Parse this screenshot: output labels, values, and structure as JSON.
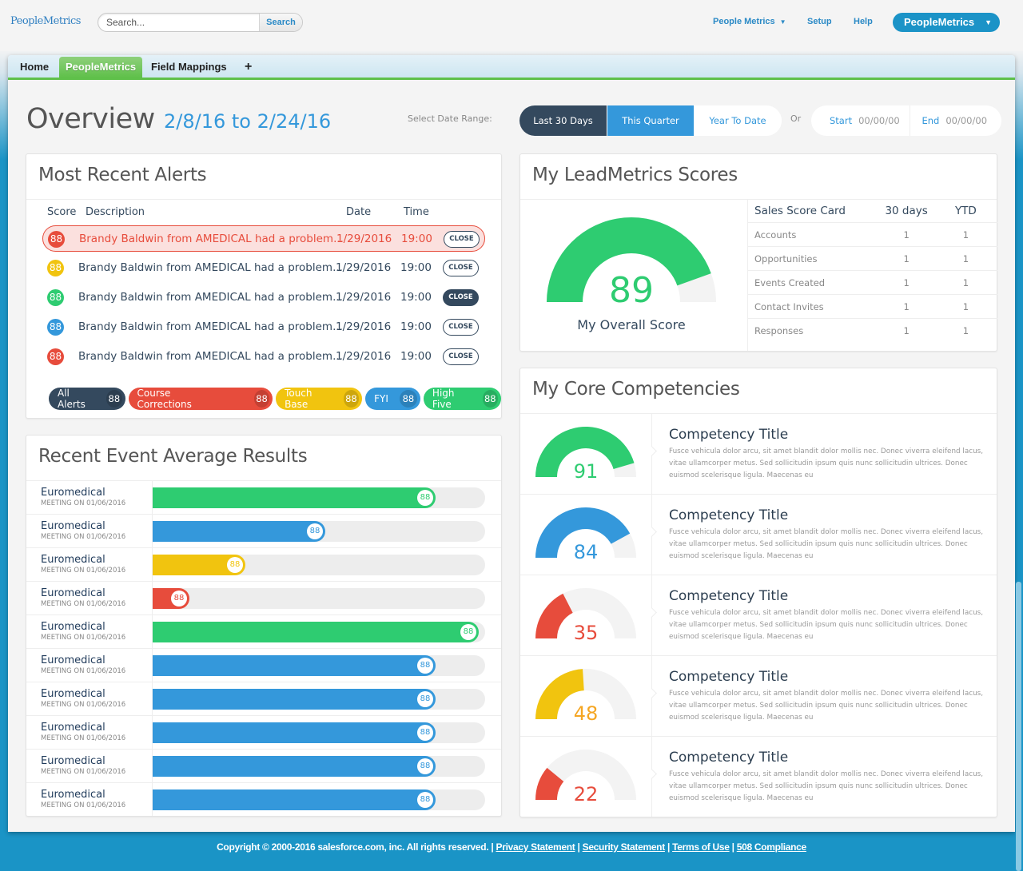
{
  "header": {
    "logo": "PeopleMetrics",
    "search_placeholder": "Search...",
    "search_button": "Search",
    "nav": [
      {
        "label": "People Metrics",
        "has_caret": true
      },
      {
        "label": "Setup"
      },
      {
        "label": "Help"
      }
    ],
    "app_menu": "PeopleMetrics"
  },
  "tabs": [
    {
      "label": "Home",
      "active": false
    },
    {
      "label": "PeopleMetrics",
      "active": true
    },
    {
      "label": "Field Mappings",
      "active": false
    },
    {
      "label": "+",
      "active": false
    }
  ],
  "overview": {
    "title": "Overview",
    "date_range": "2/8/16 to 2/24/16",
    "range_label": "Select Date Range:",
    "range_options": [
      "Last 30 Days",
      "This Quarter",
      "Year To Date"
    ],
    "or_label": "Or",
    "start_label": "Start",
    "start_value": "00/00/00",
    "end_label": "End",
    "end_value": "00/00/00"
  },
  "alerts": {
    "title": "Most Recent Alerts",
    "columns": [
      "Score",
      "Description",
      "Date",
      "Time"
    ],
    "rows": [
      {
        "score": "88",
        "color": "#e74c3c",
        "description": "Brandy Baldwin from AMEDICAL had a problem...",
        "date": "1/29/2016",
        "time": "19:00",
        "action": "CLOSE",
        "highlighted": true
      },
      {
        "score": "88",
        "color": "#f1c40f",
        "description": "Brandy Baldwin from AMEDICAL had a problem...",
        "date": "1/29/2016",
        "time": "19:00",
        "action": "CLOSE"
      },
      {
        "score": "88",
        "color": "#2ecc71",
        "description": "Brandy Baldwin from AMEDICAL had a problem...",
        "date": "1/29/2016",
        "time": "19:00",
        "action": "CLOSE",
        "action_active": true
      },
      {
        "score": "88",
        "color": "#3498db",
        "description": "Brandy Baldwin from AMEDICAL had a problem...",
        "date": "1/29/2016",
        "time": "19:00",
        "action": "CLOSE"
      },
      {
        "score": "88",
        "color": "#e74c3c",
        "description": "Brandy Baldwin from AMEDICAL had a problem...",
        "date": "1/29/2016",
        "time": "19:00",
        "action": "CLOSE"
      }
    ],
    "filters": [
      {
        "label": "All Alerts",
        "count": "88",
        "color": "#34495e"
      },
      {
        "label": "Course Corrections",
        "count": "88",
        "color": "#e74c3c"
      },
      {
        "label": "Touch Base",
        "count": "88",
        "color": "#f1c40f"
      },
      {
        "label": "FYI",
        "count": "88",
        "color": "#3498db"
      },
      {
        "label": "High Five",
        "count": "88",
        "color": "#2ecc71"
      }
    ]
  },
  "results": {
    "title": "Recent Event Average Results",
    "rows": [
      {
        "name": "Euromedical",
        "sub": "MEETING ON 01/06/2016",
        "label": "88",
        "fill_pct": 85,
        "color": "#2ecc71"
      },
      {
        "name": "Euromedical",
        "sub": "MEETING ON 01/06/2016",
        "label": "88",
        "fill_pct": 52,
        "color": "#3498db"
      },
      {
        "name": "Euromedical",
        "sub": "MEETING ON 01/06/2016",
        "label": "88",
        "fill_pct": 28,
        "color": "#f1c40f"
      },
      {
        "name": "Euromedical",
        "sub": "MEETING ON 01/06/2016",
        "label": "88",
        "fill_pct": 11,
        "color": "#e74c3c"
      },
      {
        "name": "Euromedical",
        "sub": "MEETING ON 01/06/2016",
        "label": "88",
        "fill_pct": 98,
        "color": "#2ecc71"
      },
      {
        "name": "Euromedical",
        "sub": "MEETING ON 01/06/2016",
        "label": "88",
        "fill_pct": 85,
        "color": "#3498db"
      },
      {
        "name": "Euromedical",
        "sub": "MEETING ON 01/06/2016",
        "label": "88",
        "fill_pct": 85,
        "color": "#3498db"
      },
      {
        "name": "Euromedical",
        "sub": "MEETING ON 01/06/2016",
        "label": "88",
        "fill_pct": 85,
        "color": "#3498db"
      },
      {
        "name": "Euromedical",
        "sub": "MEETING ON 01/06/2016",
        "label": "88",
        "fill_pct": 85,
        "color": "#3498db"
      },
      {
        "name": "Euromedical",
        "sub": "MEETING ON 01/06/2016",
        "label": "88",
        "fill_pct": 85,
        "color": "#3498db"
      }
    ]
  },
  "scores": {
    "title": "My LeadMetrics Scores",
    "overall_value": 89,
    "overall_label": "My Overall Score",
    "overall_color": "#2ecc71",
    "table_headers": [
      "Sales Score Card",
      "30 days",
      "YTD"
    ],
    "table_rows": [
      [
        "Accounts",
        "1",
        "1"
      ],
      [
        "Opportunities",
        "1",
        "1"
      ],
      [
        "Events Created",
        "1",
        "1"
      ],
      [
        "Contact Invites",
        "1",
        "1"
      ],
      [
        "Responses",
        "1",
        "1"
      ]
    ]
  },
  "competencies": {
    "title": "My Core Competencies",
    "items": [
      {
        "value": 91,
        "color": "#2ecc71",
        "text_color": "#2ecc71",
        "title": "Competency Title",
        "text": "Fusce vehicula dolor arcu, sit amet blandit dolor mollis nec. Donec viverra eleifend lacus, vitae ullamcorper metus. Sed sollicitudin ipsum quis nunc sollicitudin ultrices. Donec euismod scelerisque ligula. Maecenas eu"
      },
      {
        "value": 84,
        "color": "#3498db",
        "text_color": "#3498db",
        "title": "Competency Title",
        "text": "Fusce vehicula dolor arcu, sit amet blandit dolor mollis nec. Donec viverra eleifend lacus, vitae ullamcorper metus. Sed sollicitudin ipsum quis nunc sollicitudin ultrices. Donec euismod scelerisque ligula. Maecenas eu"
      },
      {
        "value": 35,
        "color": "#e74c3c",
        "text_color": "#e74c3c",
        "title": "Competency Title",
        "text": "Fusce vehicula dolor arcu, sit amet blandit dolor mollis nec. Donec viverra eleifend lacus, vitae ullamcorper metus. Sed sollicitudin ipsum quis nunc sollicitudin ultrices. Donec euismod scelerisque ligula. Maecenas eu"
      },
      {
        "value": 48,
        "color": "#f1c40f",
        "text_color": "#f5a623",
        "title": "Competency Title",
        "text": "Fusce vehicula dolor arcu, sit amet blandit dolor mollis nec. Donec viverra eleifend lacus, vitae ullamcorper metus. Sed sollicitudin ipsum quis nunc sollicitudin ultrices. Donec euismod scelerisque ligula. Maecenas eu"
      },
      {
        "value": 22,
        "color": "#e74c3c",
        "text_color": "#e74c3c",
        "title": "Competency Title",
        "text": "Fusce vehicula dolor arcu, sit amet blandit dolor mollis nec. Donec viverra eleifend lacus, vitae ullamcorper metus. Sed sollicitudin ipsum quis nunc sollicitudin ultrices. Donec euismod scelerisque ligula. Maecenas eu"
      }
    ]
  },
  "footer": {
    "copyright": "Copyright © 2000-2016 salesforce.com, inc. All rights reserved. |",
    "links": [
      "Privacy Statement",
      "Security Statement",
      "Terms of Use",
      "508 Compliance"
    ]
  }
}
